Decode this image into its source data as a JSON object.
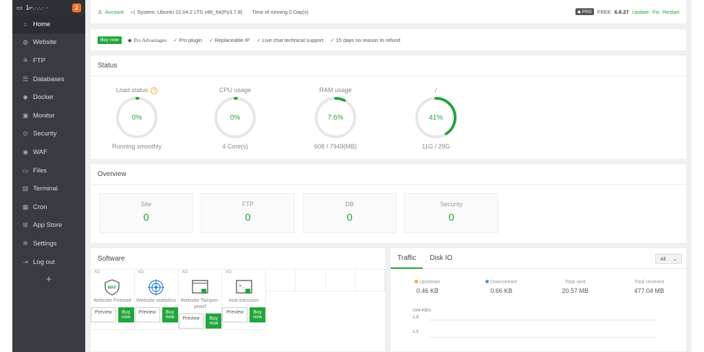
{
  "brand": {
    "host": "1⌐.·.·.· ·",
    "badge": "2"
  },
  "nav": [
    {
      "label": "Home",
      "icon": "home-icon",
      "glyph": "⌂",
      "active": true
    },
    {
      "label": "Website",
      "icon": "globe-icon",
      "glyph": "◍"
    },
    {
      "label": "FTP",
      "icon": "ftp-icon",
      "glyph": "≜"
    },
    {
      "label": "Databases",
      "icon": "database-icon",
      "glyph": "☰"
    },
    {
      "label": "Docker",
      "icon": "docker-icon",
      "glyph": "◆"
    },
    {
      "label": "Monitor",
      "icon": "monitor-icon",
      "glyph": "▣"
    },
    {
      "label": "Security",
      "icon": "shield-icon",
      "glyph": "⊙"
    },
    {
      "label": "WAF",
      "icon": "waf-icon",
      "glyph": "◉"
    },
    {
      "label": "Files",
      "icon": "folder-icon",
      "glyph": "▭"
    },
    {
      "label": "Terminal",
      "icon": "terminal-icon",
      "glyph": "▤"
    },
    {
      "label": "Cron",
      "icon": "calendar-icon",
      "glyph": "▦"
    },
    {
      "label": "App Store",
      "icon": "grid-icon",
      "glyph": "⊞"
    },
    {
      "label": "Settings",
      "icon": "gear-icon",
      "glyph": "✲"
    },
    {
      "label": "Log out",
      "icon": "logout-icon",
      "glyph": "⇥"
    }
  ],
  "plus": "+",
  "topbar": {
    "account": "Account",
    "system_label": "System:",
    "system": "Ubuntu 22.04.2 LTS x86_64(Py3.7.8)",
    "uptime": "Time of running 0 Day(s)",
    "pro": "PRO",
    "edition": "FREE",
    "version": "6.8.27",
    "update": "Update",
    "fix": "Fix",
    "restart": "Restart"
  },
  "proline": {
    "buy": "Buy now",
    "adv": "Pro Advantages",
    "items": [
      "Pro plugin",
      "Replaceable IP",
      "Live chat technical support",
      "15 days no reason to refund"
    ]
  },
  "status": {
    "title": "Status",
    "gauges": [
      {
        "title": "Load status",
        "value": "0%",
        "sub": "Running smoothly",
        "fraction": 0.0
      },
      {
        "title": "CPU usage",
        "value": "0%",
        "sub": "4 Core(s)",
        "fraction": 0.0
      },
      {
        "title": "RAM usage",
        "value": "7.6%",
        "sub": "608 / 7949(MB)",
        "fraction": 0.076
      },
      {
        "title": "/",
        "value": "41%",
        "sub": "11G / 29G",
        "fraction": 0.41
      }
    ]
  },
  "overview": {
    "title": "Overview",
    "cards": [
      {
        "label": "Site",
        "value": "0"
      },
      {
        "label": "FTP",
        "value": "0"
      },
      {
        "label": "DB",
        "value": "0"
      },
      {
        "label": "Security",
        "value": "0"
      }
    ]
  },
  "software": {
    "title": "Software",
    "ad": "AD",
    "preview": "Preview",
    "buy": "Buy now",
    "items": [
      {
        "name": "Website Firewall",
        "icon": "waf-shield-icon"
      },
      {
        "name": "Website statistics",
        "icon": "statistics-icon"
      },
      {
        "name": "Website Tamper-proof",
        "icon": "tamper-proof-icon"
      },
      {
        "name": "Anti-intrusion",
        "icon": "anti-intrusion-icon"
      }
    ]
  },
  "traffic": {
    "tab1": "Traffic",
    "tab2": "Disk IO",
    "select": "All",
    "stats": [
      {
        "label": "Upstream",
        "value": "0.46 KB",
        "dot": "#f5a623"
      },
      {
        "label": "Downstream",
        "value": "0.66 KB",
        "dot": "#4a90e2"
      },
      {
        "label": "Total sent",
        "value": "20.57 MB"
      },
      {
        "label": "Total received",
        "value": "477.04 MB"
      }
    ],
    "unit": "Unit:KB/s",
    "ticks": [
      "1.8",
      "1.5"
    ]
  },
  "colors": {
    "accent": "#20a53a",
    "sidebar": "#383c40"
  }
}
